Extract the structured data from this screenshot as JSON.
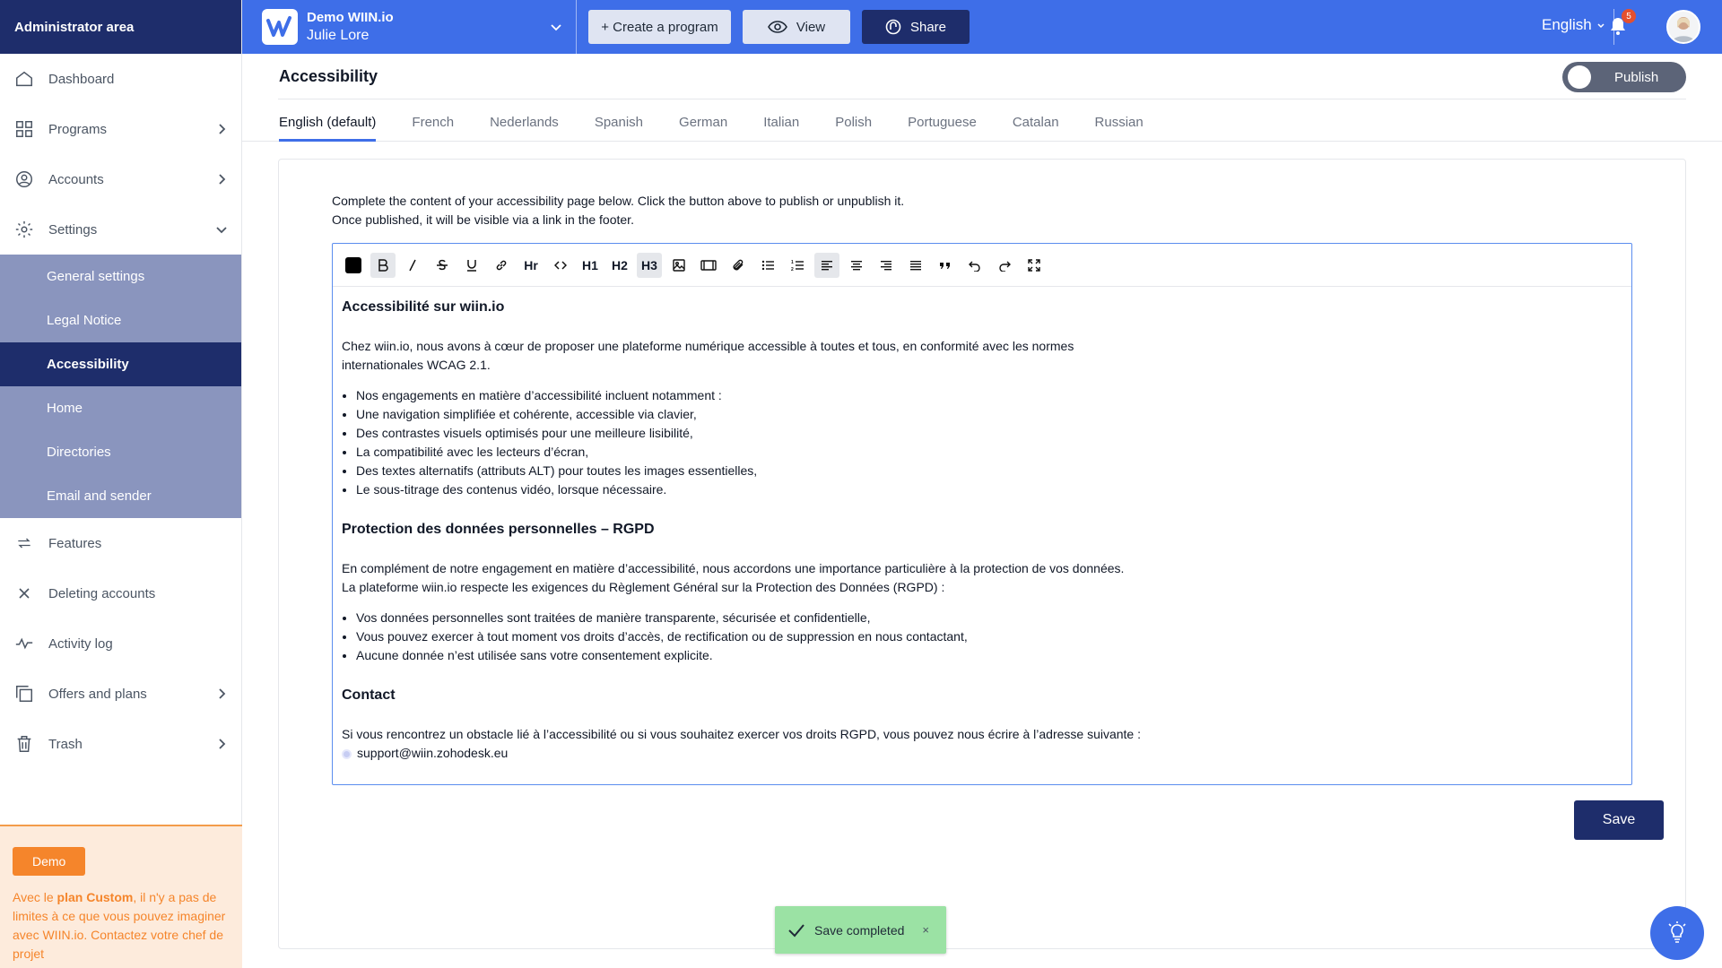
{
  "sidebar": {
    "header": "Administrator area",
    "items": [
      {
        "label": "Dashboard",
        "icon": "home-icon"
      },
      {
        "label": "Programs",
        "icon": "grid-icon"
      },
      {
        "label": "Accounts",
        "icon": "user-circle-icon"
      },
      {
        "label": "Settings",
        "icon": "gear-icon"
      }
    ],
    "settings_sub": [
      "General settings",
      "Legal Notice",
      "Accessibility",
      "Home",
      "Directories",
      "Email and sender"
    ],
    "items_after": [
      {
        "label": "Features",
        "icon": "arrows-icon"
      },
      {
        "label": "Deleting accounts",
        "icon": "close-icon"
      },
      {
        "label": "Activity log",
        "icon": "pulse-icon"
      },
      {
        "label": "Offers and plans",
        "icon": "copy-icon"
      },
      {
        "label": "Trash",
        "icon": "trash-icon"
      }
    ],
    "demo": {
      "badge": "Demo",
      "text_before": "Avec le ",
      "text_bold": "plan Custom",
      "text_after": ", il n'y a pas de limites à ce que vous pouvez imaginer avec WIIN.io. Contactez votre chef de projet"
    }
  },
  "topbar": {
    "brand_name": "Demo WIIN.io",
    "user_name": "Julie Lore",
    "create_label": "+ Create a program",
    "view_label": "View",
    "share_label": "Share",
    "language": "English",
    "notif_count": "5"
  },
  "page": {
    "title": "Accessibility",
    "publish_label": "Publish",
    "tabs": [
      "English (default)",
      "French",
      "Nederlands",
      "Spanish",
      "German",
      "Italian",
      "Polish",
      "Portuguese",
      "Catalan",
      "Russian"
    ],
    "intro_line1": "Complete the content of your accessibility page below. Click the button above to publish or unpublish it.",
    "intro_line2": "Once published, it will be visible via a link in the footer.",
    "save_label": "Save"
  },
  "editor": {
    "toolbar": [
      "Hr",
      "H1",
      "H2",
      "H3"
    ],
    "heading1": "Accessibilité sur wiin.io",
    "para1": "Chez wiin.io, nous avons à cœur de proposer une plateforme numérique accessible à toutes et tous, en conformité avec les normes",
    "para1b": "internationales WCAG 2.1.",
    "list1": [
      "Nos engagements en matière d’accessibilité incluent notamment :",
      "Une navigation simplifiée et cohérente, accessible via clavier,",
      "Des contrastes visuels optimisés pour une meilleure lisibilité,",
      "La compatibilité avec les lecteurs d’écran,",
      "Des textes alternatifs (attributs ALT) pour toutes les images essentielles,",
      "Le sous-titrage des contenus vidéo, lorsque nécessaire."
    ],
    "heading2": "Protection des données personnelles – RGPD",
    "para2": "En complément de notre engagement en matière d’accessibilité, nous accordons une importance particulière à la protection de vos données.",
    "para2b": "La plateforme wiin.io respecte les exigences du Règlement Général sur la Protection des Données (RGPD) :",
    "list2": [
      "Vos données personnelles sont traitées de manière transparente, sécurisée et confidentielle,",
      "Vous pouvez exercer à tout moment vos droits d’accès, de rectification ou de suppression en nous contactant,",
      "Aucune donnée n’est utilisée sans votre consentement explicite."
    ],
    "heading3": "Contact",
    "para3": "Si vous rencontrez un obstacle lié à l’accessibilité ou si vous souhaitez exercer vos droits RGPD, vous pouvez nous écrire à l’adresse suivante :",
    "email": "support@wiin.zohodesk.eu"
  },
  "toast": {
    "message": "Save completed",
    "close": "×"
  },
  "colors": {
    "primary": "#3e6ee8",
    "navy": "#1e2d6b",
    "submenu": "#8a95be",
    "demo_orange": "#f5852b",
    "toast_green": "#9be2a4"
  }
}
